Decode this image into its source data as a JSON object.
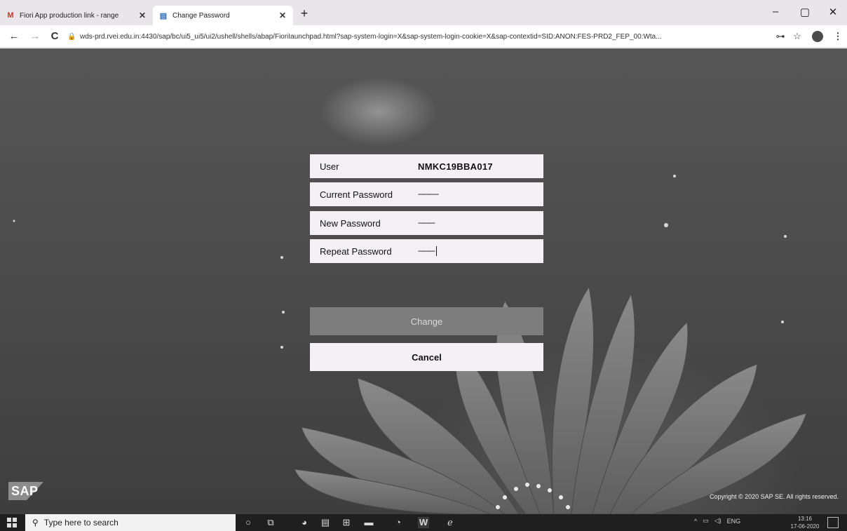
{
  "browser": {
    "tabs": [
      {
        "favicon": "M",
        "title": "Fiori App production link - range",
        "close": "✕",
        "active": false
      },
      {
        "favicon": "▤",
        "title": "Change Password",
        "close": "✕",
        "active": true
      }
    ],
    "new_tab": "+",
    "window_controls": {
      "minimize": "–",
      "maximize": "▢",
      "close": "✕"
    },
    "nav": {
      "back": "←",
      "forward": "→",
      "reload": "C"
    },
    "lock_glyph": "🔒",
    "url": "wds-prd.rvei.edu.in:4430/sap/bc/ui5_ui5/ui2/ushell/shells/abap/FioriIaunchpad.html?sap-system-login=X&sap-system-login-cookie=X&sap-contextid=SID:ANON:FES-PRD2_FEP_00:Wta...",
    "toolbar_icons": {
      "key": "⊶",
      "star": "☆",
      "menu": "⋮"
    }
  },
  "form": {
    "user_label": "User",
    "user_value": "NMKC19BBA017",
    "current_password_label": "Current Password",
    "current_password_value": "-----------",
    "new_password_label": "New Password",
    "new_password_value": "---------",
    "repeat_password_label": "Repeat Password",
    "repeat_password_value": "---------",
    "change_button": "Change",
    "cancel_button": "Cancel"
  },
  "footer": {
    "logo": "SAP",
    "copyright": "Copyright © 2020 SAP SE. All rights reserved."
  },
  "taskbar": {
    "search_placeholder": "Type here to search",
    "search_glyph": "⚲",
    "pinned_icons": [
      "cortana-icon",
      "task-view-icon",
      "chrome-icon",
      "calculator-icon",
      "store-icon",
      "explorer-icon",
      "firefox-icon",
      "word-icon",
      "edge-icon"
    ],
    "pinned_glyphs": [
      "○",
      "⧉",
      "◕",
      "▤",
      "⊞",
      "▬",
      "◔",
      "W",
      "ℯ"
    ],
    "clock_time": "13:16",
    "clock_date": "17-06-2020"
  },
  "colors": {
    "field_bg": "#f4f0f4",
    "change_button_bg": "#7d7d7d",
    "change_button_text": "#d9d9d9",
    "background": "#4c4c4c"
  }
}
